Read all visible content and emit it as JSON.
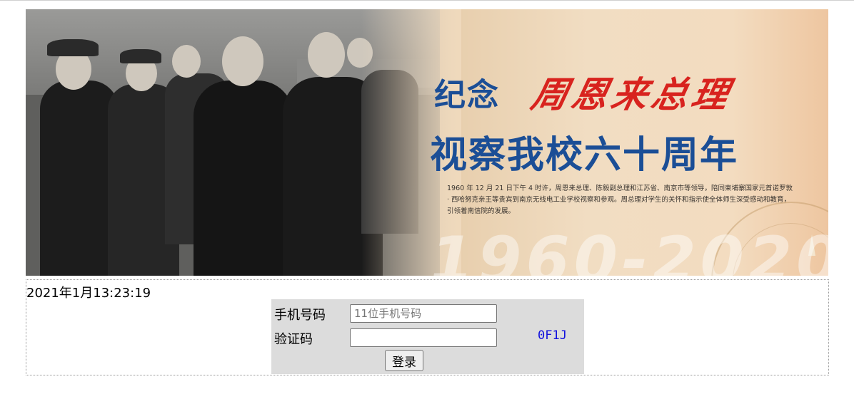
{
  "banner": {
    "title_line1_prefix": "纪念",
    "title_line1_name": "周恩来总理",
    "title_line2": "视察我校六十周年",
    "description": "1960 年 12 月 21 日下午 4 时许，周恩来总理、陈毅副总理和江苏省、南京市等领导，陪同柬埔寨国家元首诺罗敦 · 西哈努克亲王等贵宾到南京无线电工业学校视察和参观。周总理对学生的关怀和指示使全体师生深受感动和教育，引领着南信院的发展。",
    "years_watermark": "1960-2020",
    "colors": {
      "title_blue": "#1b4e96",
      "title_red": "#d8231e"
    }
  },
  "clock": {
    "datetime": "2021年1月13:23:19"
  },
  "login": {
    "phone_label": "手机号码",
    "phone_placeholder": "11位手机号码",
    "phone_value": "",
    "code_label": "验证码",
    "code_value": "",
    "captcha_text": "0F1J",
    "submit_label": "登录",
    "colors": {
      "captcha": "#1111dd",
      "box_bg": "#dcdcdc"
    }
  }
}
